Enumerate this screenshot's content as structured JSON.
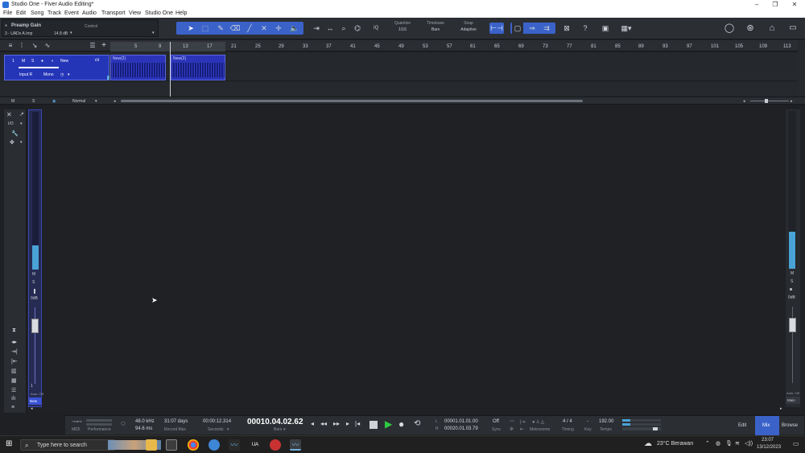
{
  "window": {
    "title": "Studio One - Fiver Audio Editing*",
    "controls": [
      "–",
      "❐",
      "✕"
    ]
  },
  "menu": [
    "File",
    "Edit",
    "Song",
    "Track",
    "Event",
    "Audio",
    "Transport",
    "View",
    "Studio One",
    "Help"
  ],
  "toolbar": {
    "param_name": "Preamp Gain",
    "param_section": "Control",
    "param_device": "3 - UADx A.Imp",
    "param_value": "14.8 dB",
    "quantize_label": "Quantize",
    "quantize_value": "1/16",
    "timebase_label": "Timebase",
    "timebase_value": "Bars",
    "snap_label": "Snap",
    "snap_value": "Adaptive",
    "iq_label": "IQ",
    "help_label": "?"
  },
  "track": {
    "number": "1",
    "mute": "M",
    "solo": "S",
    "name": "New",
    "input": "Input R",
    "mode": "Mono"
  },
  "clips": [
    {
      "name": "New(2)"
    },
    {
      "name": "New(2)"
    }
  ],
  "ruler": [
    "5",
    "9",
    "13",
    "17",
    "21",
    "25",
    "29",
    "33",
    "37",
    "41",
    "45",
    "49",
    "53",
    "57",
    "61",
    "65",
    "69",
    "73",
    "77",
    "81",
    "85",
    "89",
    "93",
    "97",
    "101",
    "105",
    "109",
    "113"
  ],
  "arrange_footer": {
    "m": "M",
    "s": "S",
    "mode": "Normal"
  },
  "mix": {
    "io": "I/O",
    "mute": "M",
    "solo": "S",
    "level": "0dB",
    "channel_number": "1",
    "automation": "Auto: Off",
    "channel_name": "New",
    "right_level": "0dB",
    "right_automation": "Auto: Off",
    "right_name": "Main"
  },
  "transport": {
    "midi_label": "MIDI",
    "performance_label": "Performance",
    "sample_rate": "48.0 kHz",
    "latency": "94.6 ms",
    "record_days": "31:07 days",
    "record_label": "Record Max",
    "seconds_value": "00:00:12.314",
    "seconds_label": "Seconds",
    "bars_value": "00010.04.02.62",
    "bars_label": "Bars",
    "loop_l_label": "L",
    "loop_r_label": "R",
    "loop_l": "00001.01.01.00",
    "loop_r": "00020.01.03.79",
    "sync_value": "Off",
    "sync_label": "Sync",
    "metronome_label": "Metronome",
    "timing_value": "4 / 4",
    "timing_label": "Timing",
    "key_value": "-",
    "key_label": "Key",
    "tempo_value": "192.00",
    "tempo_label": "Tempo",
    "tabs": [
      "Edit",
      "Mix",
      "Browse"
    ]
  },
  "taskbar": {
    "search_placeholder": "Type here to search",
    "weather": "23°C  Berawan",
    "time": "23:07",
    "date": "13/12/2023"
  },
  "colors": {
    "accent": "#3a62c9",
    "track": "#2435b8",
    "meter": "#4aa3d6",
    "play": "#2ecc40"
  }
}
